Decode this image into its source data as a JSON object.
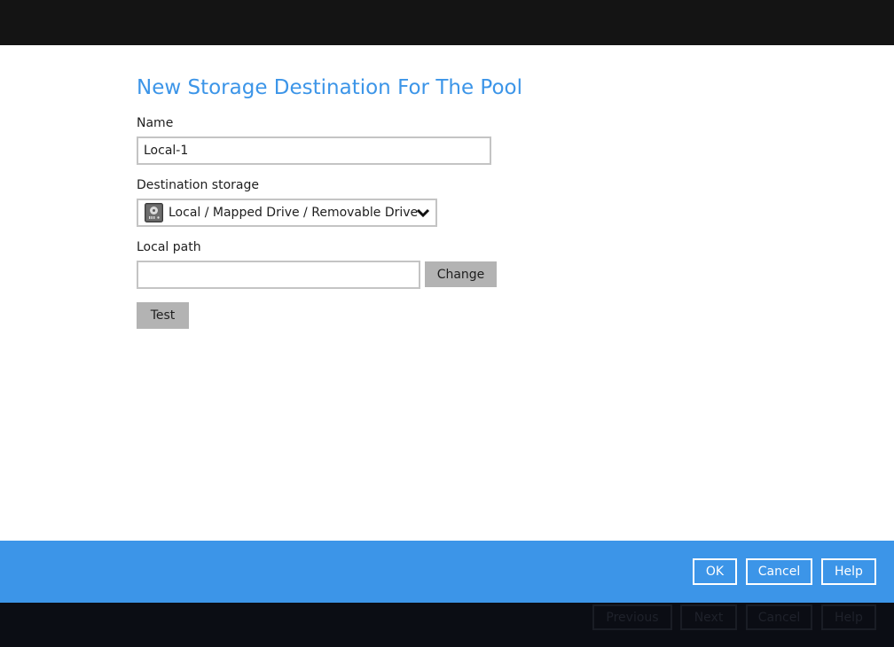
{
  "dialog": {
    "title": "New Storage Destination For The Pool",
    "name_label": "Name",
    "name_value": "Local-1",
    "destination_label": "Destination storage",
    "destination_value": "Local / Mapped Drive / Removable Drive",
    "destination_icon": "hard-drive-icon",
    "local_path_label": "Local path",
    "local_path_value": "",
    "change_label": "Change",
    "test_label": "Test"
  },
  "footer": {
    "ok_label": "OK",
    "cancel_label": "Cancel",
    "help_label": "Help"
  },
  "background_footer": {
    "previous_label": "Previous",
    "next_label": "Next",
    "cancel_label": "Cancel",
    "help_label": "Help"
  },
  "colors": {
    "accent": "#3c95e8",
    "button_gray": "#b3b3b3",
    "top_bar": "#141414",
    "bottom_bar": "#0b0d14"
  }
}
